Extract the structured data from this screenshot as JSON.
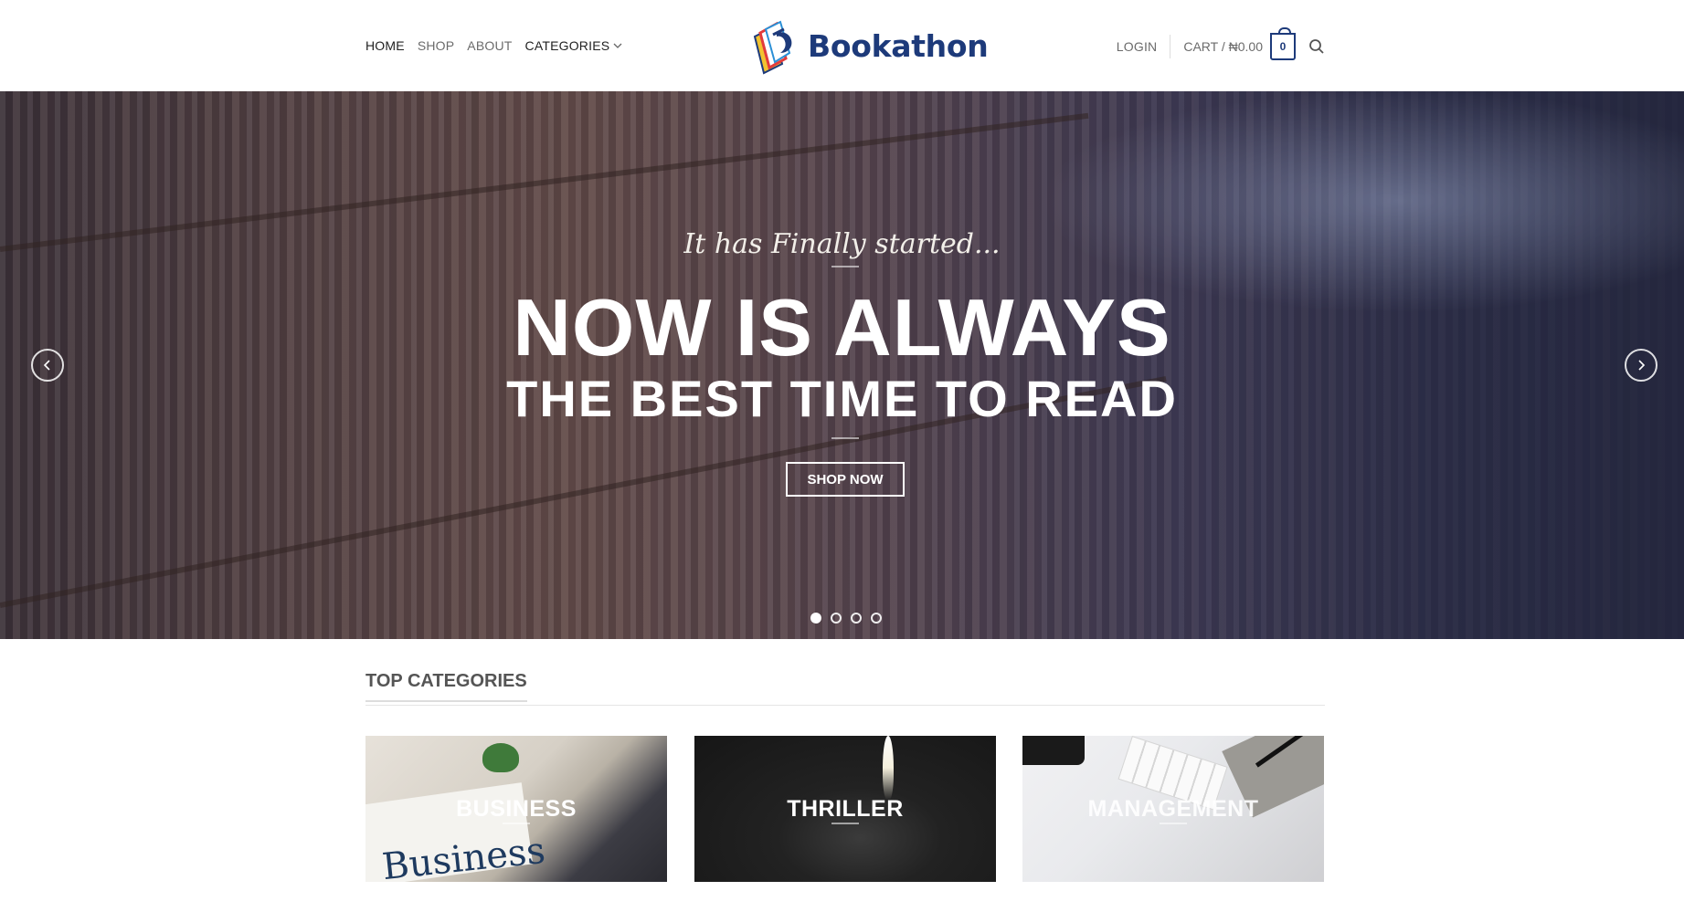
{
  "nav": {
    "home": "HOME",
    "shop": "SHOP",
    "about": "ABOUT",
    "categories": "CATEGORIES"
  },
  "brand": {
    "name": "Bookathon",
    "color": "#1d3a7a"
  },
  "account": {
    "login": "LOGIN",
    "cart_label": "CART / ₦0.00",
    "cart_count": "0"
  },
  "hero": {
    "pre_title": "It has Finally started...",
    "title": "NOW IS ALWAYS",
    "subtitle": "THE BEST TIME TO READ",
    "cta": "SHOP NOW",
    "slides_total": 4,
    "active_slide": 1
  },
  "top_categories": {
    "heading": "TOP CATEGORIES",
    "items": [
      {
        "label": "BUSINESS",
        "image_text": "Business"
      },
      {
        "label": "THRILLER"
      },
      {
        "label": "MANAGEMENT"
      }
    ]
  }
}
